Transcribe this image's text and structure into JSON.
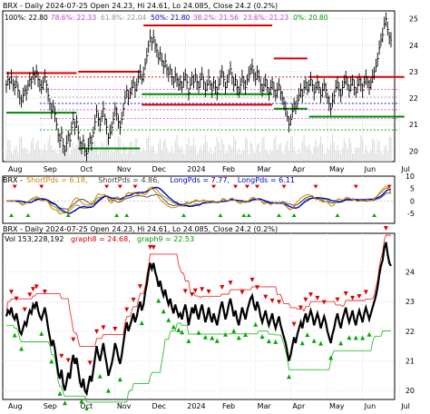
{
  "chart_data": [
    {
      "type": "line",
      "panel": "price",
      "title": "BRX - Daily 2024-07-25 Open 24.23, Hi 24.61, Lo 24.085, Close 24.2 (0.2%)",
      "fib_labels": [
        {
          "text": "100%: 22.80",
          "color": "#000000"
        },
        {
          "text": "78.6%: 22.33",
          "color": "#cc44cc"
        },
        {
          "text": "61.8%: 22.04",
          "color": "#999999"
        },
        {
          "text": "50%: 21.80",
          "color": "#0000cc"
        },
        {
          "text": "38.2%: 21.56",
          "color": "#cc44cc"
        },
        {
          "text": "23.6%: 21.23",
          "color": "#cc44cc"
        },
        {
          "text": "0%: 20.80",
          "color": "#009900"
        }
      ],
      "x_ticks": [
        "Aug",
        "Sep",
        "Oct",
        "Nov",
        "Dec",
        "2024",
        "Feb",
        "Mar",
        "Apr",
        "May",
        "Jun",
        "Jul"
      ],
      "x_tick_index": [
        0,
        21,
        43,
        65,
        86,
        107,
        128,
        149,
        170,
        192,
        213,
        235
      ],
      "y_ticks": [
        20,
        21,
        22,
        23,
        24,
        25
      ],
      "ylim": [
        19.6,
        25.3
      ],
      "close": [
        22.5,
        22.7,
        22.6,
        22.8,
        22.5,
        22.4,
        22.6,
        22.3,
        22.0,
        21.9,
        22.1,
        22.3,
        22.2,
        22.5,
        22.7,
        22.6,
        22.9,
        22.8,
        23.0,
        22.7,
        22.5,
        22.4,
        22.6,
        22.8,
        22.5,
        22.1,
        21.8,
        21.5,
        21.7,
        21.4,
        21.0,
        20.6,
        20.4,
        20.7,
        20.2,
        20.0,
        20.3,
        20.6,
        20.4,
        20.9,
        21.2,
        20.9,
        21.1,
        20.7,
        20.3,
        20.1,
        20.4,
        20.0,
        19.9,
        20.2,
        20.5,
        20.3,
        20.7,
        21.1,
        21.5,
        21.2,
        21.0,
        21.3,
        21.6,
        21.2,
        20.9,
        20.5,
        20.7,
        20.9,
        21.2,
        21.6,
        21.4,
        21.1,
        20.9,
        21.2,
        21.6,
        22.0,
        22.3,
        22.0,
        22.2,
        22.4,
        22.6,
        22.3,
        22.5,
        22.8,
        23.0,
        22.7,
        22.9,
        23.3,
        23.6,
        24.0,
        24.3,
        24.1,
        24.3,
        24.0,
        23.8,
        23.5,
        23.7,
        23.4,
        23.2,
        23.4,
        23.1,
        22.9,
        23.1,
        22.8,
        22.6,
        22.9,
        22.7,
        22.5,
        22.6,
        22.4,
        22.7,
        22.9,
        22.6,
        22.2,
        22.5,
        22.8,
        22.6,
        22.9,
        22.6,
        22.4,
        22.7,
        22.9,
        22.6,
        22.3,
        22.5,
        22.8,
        22.5,
        22.3,
        22.6,
        22.4,
        22.2,
        22.5,
        22.8,
        23.0,
        22.7,
        22.4,
        22.6,
        22.9,
        23.1,
        22.8,
        22.5,
        22.7,
        22.4,
        22.2,
        22.5,
        22.8,
        22.6,
        22.4,
        22.7,
        22.9,
        23.1,
        23.2,
        22.9,
        22.7,
        23.0,
        22.8,
        22.5,
        22.3,
        22.5,
        22.7,
        22.4,
        22.2,
        22.4,
        22.6,
        22.3,
        22.1,
        22.3,
        22.5,
        22.2,
        22.0,
        21.8,
        21.6,
        21.3,
        21.0,
        21.2,
        21.5,
        21.8,
        21.6,
        21.9,
        22.1,
        22.3,
        22.1,
        22.4,
        22.6,
        22.3,
        22.5,
        22.7,
        22.5,
        22.2,
        22.4,
        22.6,
        22.4,
        22.1,
        22.3,
        22.5,
        22.3,
        22.0,
        21.8,
        21.6,
        21.9,
        22.1,
        22.4,
        22.6,
        22.3,
        22.1,
        22.4,
        22.6,
        22.8,
        22.5,
        22.3,
        22.5,
        22.7,
        22.4,
        22.2,
        22.5,
        22.7,
        22.5,
        22.3,
        22.6,
        22.8,
        22.6,
        22.4,
        22.6,
        22.8,
        23.0,
        23.2,
        23.5,
        23.9,
        24.2,
        24.4,
        24.8,
        25.0,
        24.6,
        24.3,
        24.2
      ],
      "fib_lines": [
        {
          "value": 22.8,
          "color": "#cc0000",
          "range": [
            0,
            235
          ]
        },
        {
          "value": 22.33,
          "color": "#cc44cc",
          "range": [
            20,
            235
          ]
        },
        {
          "value": 22.04,
          "color": "#aaaaaa",
          "range": [
            20,
            235
          ]
        },
        {
          "value": 21.8,
          "color": "#0000cc",
          "range": [
            20,
            235
          ]
        },
        {
          "value": 21.56,
          "color": "#cc44cc",
          "range": [
            20,
            235
          ]
        },
        {
          "value": 21.23,
          "color": "#cc44cc",
          "range": [
            20,
            235
          ]
        },
        {
          "value": 20.8,
          "color": "#009900",
          "range": [
            20,
            235
          ]
        }
      ],
      "resistance_segments": [
        {
          "value": 22.95,
          "range": [
            0,
            42
          ]
        },
        {
          "value": 23.0,
          "range": [
            43,
            80
          ]
        },
        {
          "value": 21.75,
          "range": [
            81,
            159
          ]
        },
        {
          "value": 24.75,
          "range": [
            82,
            159
          ]
        },
        {
          "value": 23.5,
          "range": [
            160,
            180
          ]
        },
        {
          "value": 22.8,
          "range": [
            181,
            238
          ]
        }
      ],
      "support_segments": [
        {
          "value": 21.45,
          "range": [
            0,
            42
          ]
        },
        {
          "value": 20.1,
          "range": [
            43,
            80
          ]
        },
        {
          "value": 22.15,
          "range": [
            81,
            159
          ]
        },
        {
          "value": 21.6,
          "range": [
            160,
            180
          ]
        },
        {
          "value": 21.3,
          "range": [
            181,
            238
          ]
        }
      ]
    },
    {
      "type": "line",
      "panel": "oscillator",
      "title_prefix": "BRX - ",
      "legend": [
        {
          "text": "ShortPds = 6.18,",
          "color": "#cc8800"
        },
        {
          "text": "ShortPds = 4.86,",
          "color": "#444444"
        },
        {
          "text": "LongPds = 7.77,",
          "color": "#0000cc"
        },
        {
          "text": "LongPds = 6.11",
          "color": "#0000cc"
        }
      ],
      "y_ticks": [
        10,
        5,
        0,
        -5
      ],
      "ylim": [
        -9,
        10
      ]
    },
    {
      "type": "line",
      "panel": "guppy",
      "title": "BRX - Daily 2024-07-25 Open 24.23, Hi 24.61, Lo 24.085, Close 24.2 (0.2%)",
      "legend": [
        {
          "text": "Vol 153,228,192",
          "color": "#000000"
        },
        {
          "text": "graph8 = 24.68,",
          "color": "#cc0000"
        },
        {
          "text": "graph9 = 22.53",
          "color": "#009900"
        }
      ],
      "y_ticks": [
        20,
        21,
        22,
        23,
        24
      ],
      "ylim": [
        19.7,
        25.3
      ],
      "x_ticks": [
        "Aug",
        "Sep",
        "Oct",
        "Nov",
        "Dec",
        "2024",
        "Feb",
        "Mar",
        "Apr",
        "May",
        "Jun",
        "Jul"
      ]
    }
  ]
}
